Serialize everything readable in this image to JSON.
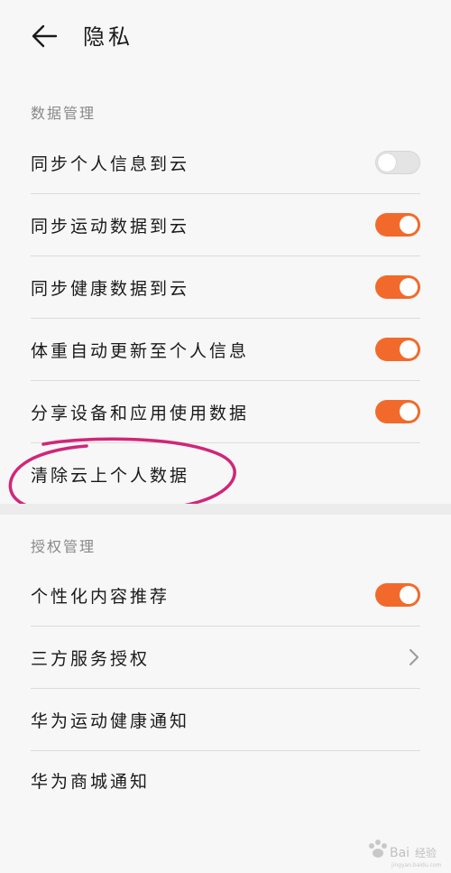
{
  "header": {
    "title": "隐私",
    "back_icon": "arrow-left-icon"
  },
  "sections": {
    "data_mgmt_label": "数据管理",
    "auth_mgmt_label": "授权管理"
  },
  "rows": {
    "sync_personal": {
      "label": "同步个人信息到云",
      "toggle": "off"
    },
    "sync_sport": {
      "label": "同步运动数据到云",
      "toggle": "on"
    },
    "sync_health": {
      "label": "同步健康数据到云",
      "toggle": "on"
    },
    "weight_auto": {
      "label": "体重自动更新至个人信息",
      "toggle": "on"
    },
    "share_device": {
      "label": "分享设备和应用使用数据",
      "toggle": "on"
    },
    "clear_cloud": {
      "label": "清除云上个人数据"
    },
    "personalized": {
      "label": "个性化内容推荐",
      "toggle": "on"
    },
    "third_party": {
      "label": "三方服务授权"
    },
    "huawei_health_notify": {
      "label": "华为运动健康通知"
    },
    "huawei_mall_notify": {
      "label": "华为商城通知"
    }
  },
  "colors": {
    "accent": "#f26a2b",
    "annotation": "#d0267a",
    "background": "#f7f7f7"
  },
  "watermark": {
    "text": "Bai经验",
    "sub": "jingyan.baidu.com"
  }
}
